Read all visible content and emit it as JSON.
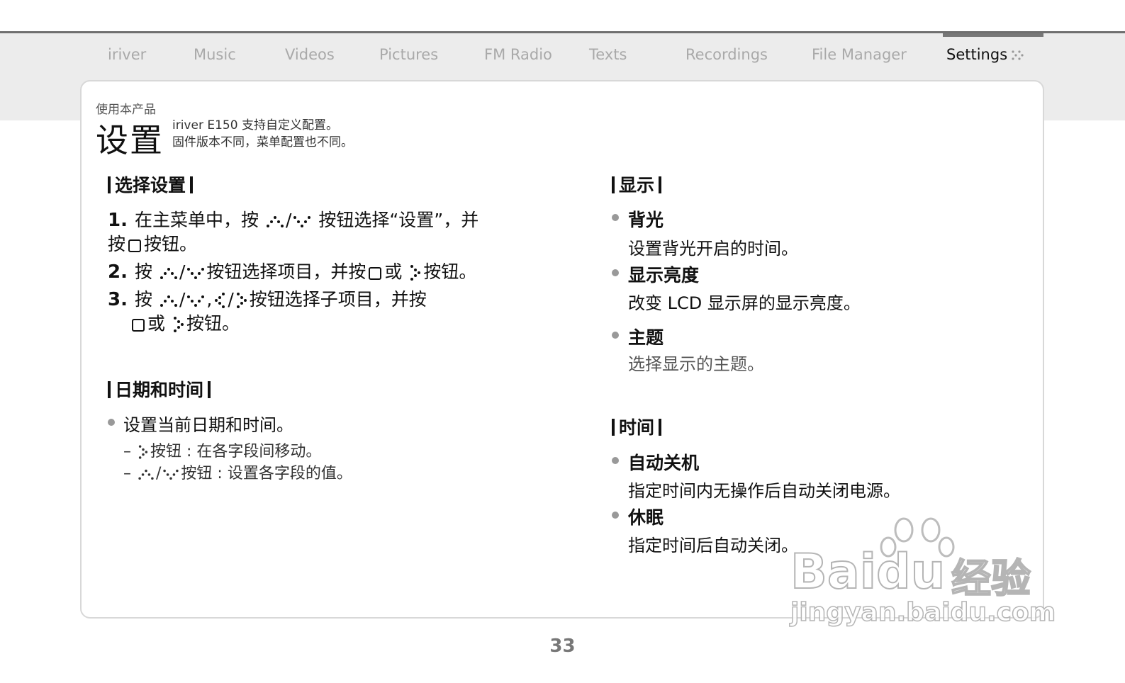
{
  "nav": {
    "items": [
      "iriver",
      "Music",
      "Videos",
      "Pictures",
      "FM Radio",
      "Texts",
      "Recordings",
      "File Manager",
      "Settings"
    ],
    "active_index": 8
  },
  "header": {
    "breadcrumb": "使用本产品",
    "title": "设置",
    "intro_1": "iriver E150 支持自定义配置。",
    "intro_2": "固件版本不同，菜单配置也不同。"
  },
  "select_settings": {
    "heading": "选择设置",
    "step1_num": "1.",
    "step1_a": "在主菜单中，按",
    "step1_b": "按钮选择“设置”，并",
    "step1_c": "按",
    "step1_d": "按钮。",
    "step2_num": "2.",
    "step2_a": "按",
    "step2_b": "按钮选择项目，并按",
    "step2_c": "或",
    "step2_d": "按钮。",
    "step3_num": "3.",
    "step3_a": "按",
    "step3_b": "按钮选择子项目，并按",
    "step3_c": "或",
    "step3_d": "按钮。",
    "slash": "/",
    "comma": ","
  },
  "date_time": {
    "heading": "日期和时间",
    "bullet": "设置当前日期和时间。",
    "dash": "–",
    "sub1_b": "按钮 : 在各字段间移动。",
    "sub2_b": "按钮 : 设置各字段的值。"
  },
  "display": {
    "heading": "显示",
    "items": [
      {
        "title": "背光",
        "desc": "设置背光开启的时间。"
      },
      {
        "title": "显示亮度",
        "desc": "改变 LCD 显示屏的显示亮度。"
      },
      {
        "title": "主题",
        "desc": "选择显示的主题。"
      }
    ]
  },
  "time": {
    "heading": "时间",
    "items": [
      {
        "title": "自动关机",
        "desc": "指定时间内无操作后自动关闭电源。"
      },
      {
        "title": "休眠",
        "desc": "指定时间后自动关闭。"
      }
    ]
  },
  "page_number": "33",
  "watermark": {
    "brand": "Bai",
    "brand2": "du",
    "cn": "经验",
    "url": "jingyan.baidu.com"
  },
  "colors": {
    "nav_inactive": "#a9a9a9",
    "nav_band": "#ececec",
    "card_border": "#d8d8d8"
  }
}
